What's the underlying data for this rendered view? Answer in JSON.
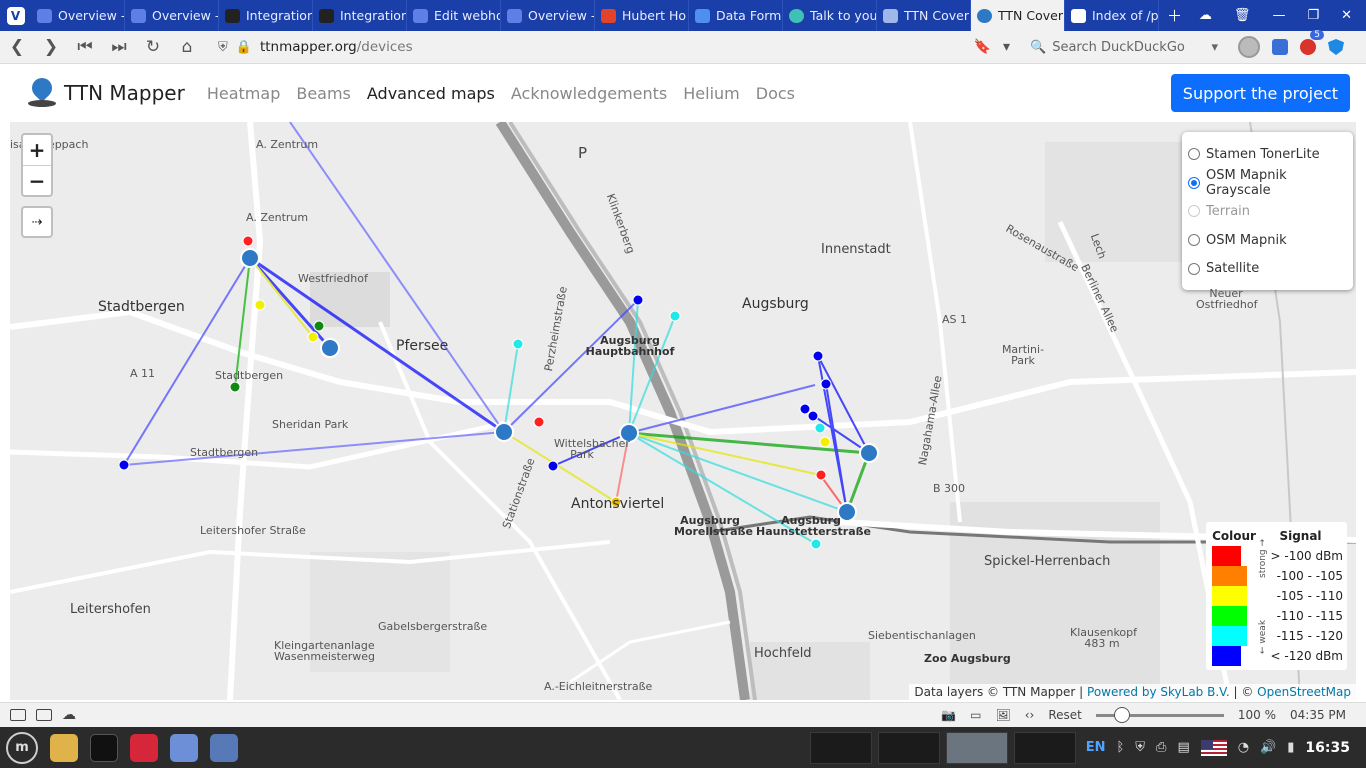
{
  "browser": {
    "tabs": [
      {
        "label": "Overview -",
        "active": false
      },
      {
        "label": "Overview -",
        "active": false
      },
      {
        "label": "Integration",
        "active": false
      },
      {
        "label": "Integration",
        "active": false
      },
      {
        "label": "Edit webho",
        "active": false
      },
      {
        "label": "Overview -",
        "active": false
      },
      {
        "label": "Hubert Ho",
        "active": false
      },
      {
        "label": "Data Form",
        "active": false
      },
      {
        "label": "Talk to you",
        "active": false
      },
      {
        "label": "TTN Cover",
        "active": false
      },
      {
        "label": "TTN Cover",
        "active": true
      },
      {
        "label": "Index of /p",
        "active": false
      }
    ],
    "url_host": "ttnmapper.org",
    "url_path": "/devices",
    "search_placeholder": "Search DuckDuckGo",
    "extension_badge": "5"
  },
  "site": {
    "brand": "TTN Mapper",
    "nav": [
      {
        "label": "Heatmap",
        "active": false
      },
      {
        "label": "Beams",
        "active": false
      },
      {
        "label": "Advanced maps",
        "active": true
      },
      {
        "label": "Acknowledgements",
        "active": false
      },
      {
        "label": "Helium",
        "active": false
      },
      {
        "label": "Docs",
        "active": false
      }
    ],
    "support_button": "Support the project"
  },
  "map": {
    "zoom_in": "+",
    "zoom_out": "−",
    "fullscreen": "⇢",
    "layers": [
      {
        "label": "Stamen TonerLite",
        "selected": false,
        "disabled": false
      },
      {
        "label": "OSM Mapnik Grayscale",
        "selected": true,
        "disabled": false
      },
      {
        "label": "Terrain",
        "selected": false,
        "disabled": true
      },
      {
        "label": "OSM Mapnik",
        "selected": false,
        "disabled": false
      },
      {
        "label": "Satellite",
        "selected": false,
        "disabled": false
      }
    ],
    "place_labels": [
      "isaß-Steppach",
      "A. Zentrum",
      "A. Zentrum",
      "Westfriedhof",
      "Stadtbergen",
      "Pfersee",
      "A 11",
      "Stadtbergen",
      "Sheridan Park",
      "Stadtbergen",
      "Leitershofer Straße",
      "Leitershofen",
      "Gabelsbergerstraße",
      "Kleingartenanlage Wasenmeisterweg",
      "A.-Eichleitnerstraße",
      "Augsburg Hauptbahnhof",
      "Wittelsbacher Park",
      "Antonsviertel",
      "Augsburg Morellstraße",
      "Augsburg Haunstetterstraße",
      "Augsburg",
      "Innenstadt",
      "AS 1",
      "Martini-Park",
      "B 300",
      "Spickel-Herrenbach",
      "Hochfeld",
      "Siebentischanlagen",
      "Zoo Augsburg",
      "Klausenkopf 483 m",
      "Neuer Ostfriedhof",
      "Perzheimstraße",
      "Stationstraße",
      "Klinkerberg",
      "Berliner Allee",
      "Nagahama-Allee",
      "Lech",
      "Rosenaustraße",
      "P"
    ],
    "legend": {
      "header_colour": "Colour",
      "header_signal": "Signal",
      "strong_label": "strong →",
      "weak_label": "← weak",
      "rows": [
        {
          "color": "#ff0000",
          "signal": "> -100 dBm"
        },
        {
          "color": "#ff7f00",
          "signal": "-100 - -105"
        },
        {
          "color": "#ffff00",
          "signal": "-105 - -110"
        },
        {
          "color": "#00ff00",
          "signal": "-110 - -115"
        },
        {
          "color": "#00ffff",
          "signal": "-115 - -120"
        },
        {
          "color": "#0000ff",
          "signal": "< -120 dBm"
        }
      ]
    },
    "attribution": {
      "prefix": "Data layers © TTN Mapper |",
      "skylab": "Powered by SkyLab B.V.",
      "sep": "| ©",
      "osm": "OpenStreetMap"
    }
  },
  "statusbar": {
    "reset": "Reset",
    "zoom": "100 %",
    "time": "04:35 PM"
  },
  "taskbar": {
    "lang": "EN",
    "clock": "16:35"
  }
}
